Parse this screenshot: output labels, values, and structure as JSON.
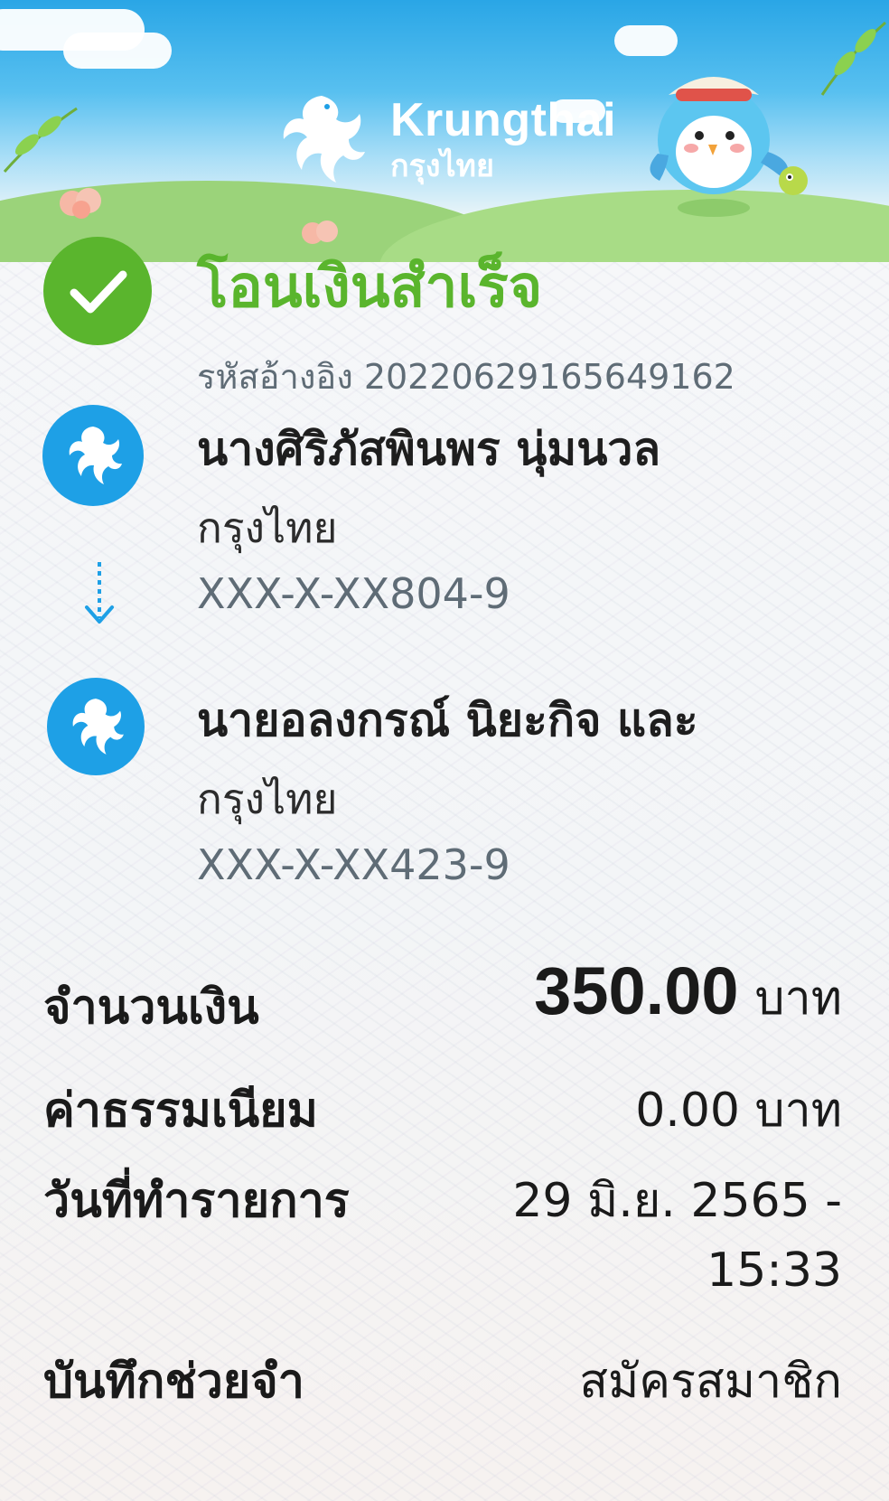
{
  "header": {
    "brand_en": "Krungthai",
    "brand_th": "กรุงไทย",
    "logo_icon": "krungthai-phoenix-icon",
    "mascot_icon": "bird-mascot-icon"
  },
  "status": {
    "title": "โอนเงินสำเร็จ",
    "reference": "รหัสอ้างอิง 2022062916564916​2",
    "icon": "check-icon",
    "color": "#5ab52d"
  },
  "sender": {
    "name": "นางศิริภัสพินพร นุ่มนวล",
    "bank": "กรุงไทย",
    "account": "XXX-X-XX804-9"
  },
  "receiver": {
    "name": "นายอลงกรณ์ นิยะกิจ และ",
    "bank": "กรุงไทย",
    "account": "XXX-X-XX423-9"
  },
  "details": {
    "amount_label": "จำนวนเงิน",
    "amount_value": "350.00",
    "amount_unit": "บาท",
    "fee_label": "ค่าธรรมเนียม",
    "fee_value": "0.00 บาท",
    "date_label": "วันที่ทำรายการ",
    "date_value_line1": "29 มิ.ย. 2565 -",
    "date_value_line2": "15:33",
    "memo_label": "บันทึกช่วยจำ",
    "memo_value": "สมัครสมาชิก"
  },
  "colors": {
    "brand_blue": "#1ea0e6",
    "success_green": "#5ab52d"
  }
}
